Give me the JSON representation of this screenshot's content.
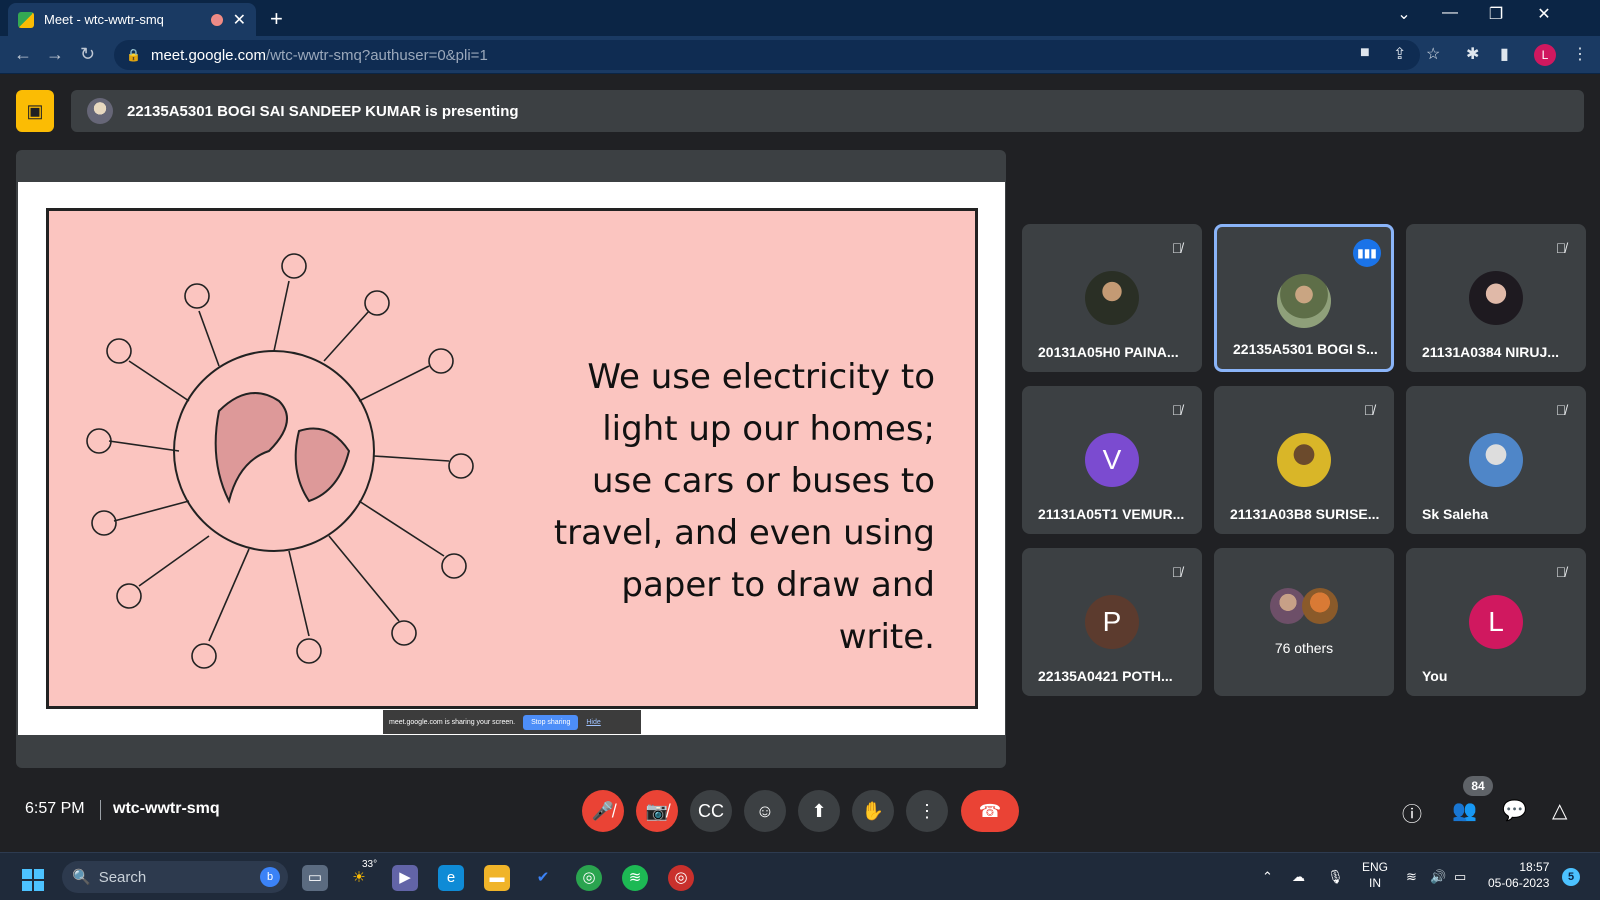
{
  "browser": {
    "tab_title": "Meet - wtc-wwtr-smq",
    "url_host": "meet.google.com",
    "url_path": "/wtc-wwtr-smq?authuser=0&pli=1",
    "profile_letter": "L"
  },
  "presenting": {
    "text": "22135A5301 BOGI SAI SANDEEP KUMAR is presenting"
  },
  "slide": {
    "text": "We use electricity to light up our homes; use cars or buses to travel, and even using paper to draw and write.",
    "share_notice": "meet.google.com is sharing your screen.",
    "stop_sharing": "Stop sharing",
    "hide": "Hide"
  },
  "participants": [
    {
      "name": "20131A05H0 PAINA...",
      "muted": true
    },
    {
      "name": "22135A5301 BOGI S...",
      "speaking": true
    },
    {
      "name": "21131A0384 NIRUJ...",
      "muted": true
    },
    {
      "name": "21131A05T1 VEMUR...",
      "initial": "V",
      "color": "#7b4bd0",
      "muted": true
    },
    {
      "name": "21131A03B8 SURISE...",
      "muted": true
    },
    {
      "name": "Sk Saleha",
      "muted": true
    },
    {
      "name": "22135A0421 POTH...",
      "initial": "P",
      "color": "#5c3b2e",
      "muted": true
    },
    {
      "name": "76 others"
    },
    {
      "name": "You",
      "initial": "L",
      "color": "#d0185f",
      "muted": true
    }
  ],
  "meeting": {
    "time": "6:57 PM",
    "code": "wtc-wwtr-smq",
    "people_count": "84"
  },
  "taskbar": {
    "search_placeholder": "Search",
    "weather": "33°",
    "lang_top": "ENG",
    "lang_bottom": "IN",
    "time": "18:57",
    "date": "05-06-2023",
    "notifications": "5"
  }
}
